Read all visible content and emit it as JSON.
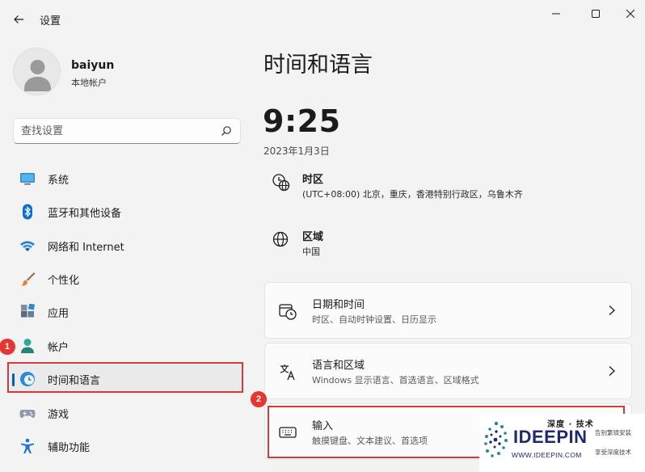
{
  "window": {
    "title": "设置",
    "controls": [
      "minimize",
      "maximize",
      "close"
    ]
  },
  "profile": {
    "name": "baiyun",
    "account_type": "本地帐户"
  },
  "search": {
    "placeholder": "查找设置"
  },
  "sidebar": {
    "items": [
      {
        "label": "系统",
        "icon": "monitor-icon"
      },
      {
        "label": "蓝牙和其他设备",
        "icon": "bluetooth-icon"
      },
      {
        "label": "网络和 Internet",
        "icon": "wifi-icon"
      },
      {
        "label": "个性化",
        "icon": "brush-icon"
      },
      {
        "label": "应用",
        "icon": "apps-icon"
      },
      {
        "label": "帐户",
        "icon": "person-icon"
      },
      {
        "label": "时间和语言",
        "icon": "clock-globe-icon",
        "selected": true
      },
      {
        "label": "游戏",
        "icon": "gamepad-icon"
      },
      {
        "label": "辅助功能",
        "icon": "accessibility-icon"
      }
    ]
  },
  "annotations": {
    "step1": "1",
    "step2": "2",
    "highlight_color": "#d9363e"
  },
  "main": {
    "title": "时间和语言",
    "time": "9:25",
    "date": "2023年1月3日",
    "timezone": {
      "title": "时区",
      "value": "(UTC+08:00) 北京，重庆，香港特别行政区，乌鲁木齐"
    },
    "region": {
      "title": "区域",
      "value": "中国"
    },
    "cards": [
      {
        "title": "日期和时间",
        "subtitle": "时区、自动时钟设置、日历显示",
        "icon": "calendar-clock-icon"
      },
      {
        "title": "语言和区域",
        "subtitle": "Windows 显示语言、首选语言、区域格式",
        "icon": "language-icon"
      },
      {
        "title": "输入",
        "subtitle": "触摸键盘、文本建议、首选项",
        "icon": "keyboard-icon"
      }
    ]
  },
  "watermark": {
    "top_text": "深度 · 技术",
    "brand": "IDEEPIN",
    "url": "WWW.IDEEPIN.COM",
    "side1": "告别繁琐安装",
    "side2": "享受深度技术"
  },
  "colors": {
    "accent": "#005fb8",
    "background": "#f3f3f3",
    "annotation_red": "#e5372f"
  }
}
